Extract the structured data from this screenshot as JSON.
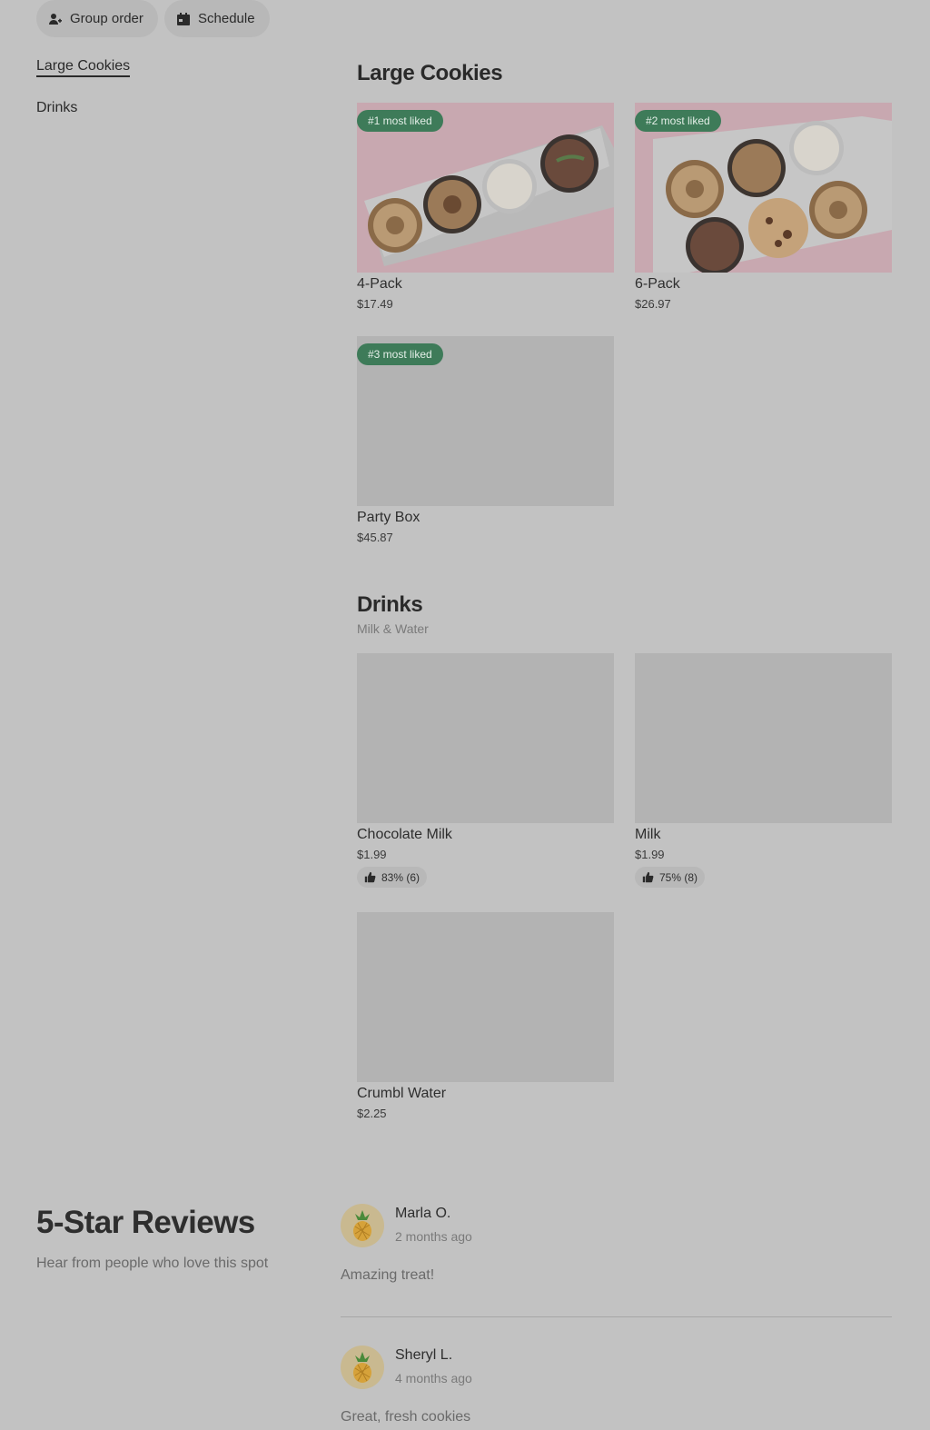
{
  "toolbar": {
    "group_order_label": "Group order",
    "schedule_label": "Schedule"
  },
  "nav": {
    "items": [
      {
        "label": "Large Cookies",
        "active": true
      },
      {
        "label": "Drinks",
        "active": false
      }
    ]
  },
  "sections": [
    {
      "title": "Large Cookies",
      "subtitle": "",
      "items": [
        {
          "name": "4-Pack",
          "price": "$17.49",
          "badge": "#1 most liked"
        },
        {
          "name": "6-Pack",
          "price": "$26.97",
          "badge": "#2 most liked"
        },
        {
          "name": "Party Box",
          "price": "$45.87",
          "badge": "#3 most liked"
        }
      ]
    },
    {
      "title": "Drinks",
      "subtitle": "Milk & Water",
      "items": [
        {
          "name": "Chocolate Milk",
          "price": "$1.99",
          "rating": "83% (6)"
        },
        {
          "name": "Milk",
          "price": "$1.99",
          "rating": "75% (8)"
        },
        {
          "name": "Crumbl Water",
          "price": "$2.25"
        }
      ]
    }
  ],
  "reviews": {
    "title": "5-Star Reviews",
    "subtitle": "Hear from people who love this spot",
    "items": [
      {
        "name": "Marla O.",
        "time": "2 months ago",
        "text": "Amazing treat!"
      },
      {
        "name": "Sheryl L.",
        "time": "4 months ago",
        "text": "Great, fresh cookies"
      }
    ]
  },
  "colors": {
    "badge_bg": "#3e7b59",
    "overlay_bg": "#c2c2c2"
  },
  "icons": {
    "group_order": "person-plus-icon",
    "schedule": "calendar-icon",
    "rating": "thumbs-up-icon",
    "avatar": "pineapple-icon"
  }
}
